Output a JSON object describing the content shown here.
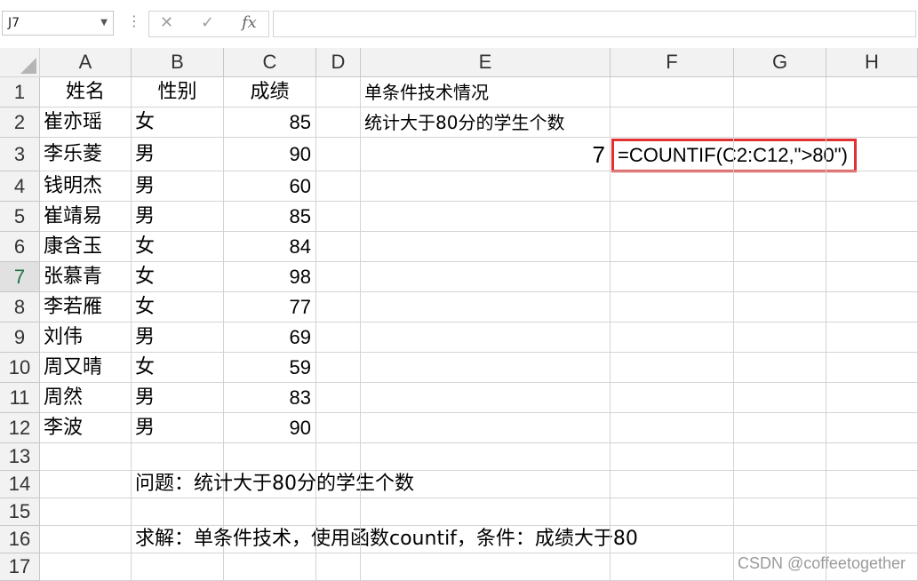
{
  "name_box": "J7",
  "formula_icons": [
    "close-icon",
    "check-icon",
    "fx-icon"
  ],
  "fx_label": "fx",
  "columns": [
    "A",
    "B",
    "C",
    "D",
    "E",
    "F",
    "G",
    "H"
  ],
  "rows": [
    "1",
    "2",
    "3",
    "4",
    "5",
    "6",
    "7",
    "8",
    "9",
    "10",
    "11",
    "12",
    "13",
    "14",
    "15",
    "16",
    "17"
  ],
  "selected_row": "7",
  "cells": {
    "A1": "姓名",
    "B1": "性别",
    "C1": "成绩",
    "A2": "崔亦瑶",
    "B2": "女",
    "C2": "85",
    "A3": "李乐菱",
    "B3": "男",
    "C3": "90",
    "A4": "钱明杰",
    "B4": "男",
    "C4": "60",
    "A5": "崔靖易",
    "B5": "男",
    "C5": "85",
    "A6": "康含玉",
    "B6": "女",
    "C6": "84",
    "A7": "张慕青",
    "B7": "女",
    "C7": "98",
    "A8": "李若雁",
    "B8": "女",
    "C8": "77",
    "A9": "刘伟",
    "B9": "男",
    "C9": "69",
    "A10": "周又晴",
    "B10": "女",
    "C10": "59",
    "A11": "周然",
    "B11": "男",
    "C11": "83",
    "A12": "李波",
    "B12": "男",
    "C12": "90",
    "E1": "单条件技术情况",
    "E2": "统计大于80分的学生个数",
    "E3": "7",
    "F3": "=COUNTIF(C2:C12,\">80\")",
    "B14": "问题：统计大于80分的学生个数",
    "B16": "求解：单条件技术，使用函数countif，条件：成绩大于80"
  },
  "watermark": "CSDN @coffeetogether"
}
